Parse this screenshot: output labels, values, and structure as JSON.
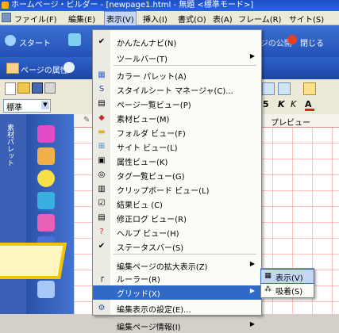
{
  "window": {
    "title": "ホームページ・ビルダー - [newpage1.html - 無題 <標準モード>]"
  },
  "menubar": {
    "items": [
      "ファイル(F)",
      "編集(E)",
      "表示(V)",
      "挿入(I)",
      "書式(O)",
      "表(A)",
      "フレーム(R)",
      "サイト(S)"
    ]
  },
  "navbar": {
    "start_label": "スタート",
    "properties_label": "ページの属性",
    "publish_label": "ページの公開",
    "close_label": "閉じる"
  },
  "toolbar": {
    "style_value": "標準",
    "font_size": "5",
    "preview_tab": "プレビュー"
  },
  "left_panel": {
    "tab_label": "素材パレット"
  },
  "menu": {
    "items": [
      {
        "label": "かんたんナビ(N)",
        "icon": "checkmark-icon"
      },
      {
        "label": "ツールバー(T)",
        "icon": ""
      },
      {
        "label": "カラー パレット(A)",
        "icon": "palette-icon"
      },
      {
        "label": "スタイルシート マネージャ(C)...",
        "icon": "stylesheet-icon"
      },
      {
        "label": "ページ一覧ビュー(P)",
        "icon": "page-list-icon"
      },
      {
        "label": "素材ビュー(M)",
        "icon": "materials-icon"
      },
      {
        "label": "フォルダ ビュー(F)",
        "icon": "folder-icon"
      },
      {
        "label": "サイト ビュー(L)",
        "icon": "site-icon"
      },
      {
        "label": "属性ビュー(K)",
        "icon": "attributes-icon"
      },
      {
        "label": "タグ一覧ビュー(G)",
        "icon": "tag-list-icon"
      },
      {
        "label": "クリップボード ビュー(L)",
        "icon": "clipboard-icon"
      },
      {
        "label": "結果ビュ (C)",
        "icon": "results-icon"
      },
      {
        "label": "修正ログ ビュー(R)",
        "icon": "log-icon"
      },
      {
        "label": "ヘルプ ビュー(H)",
        "icon": "help-icon"
      },
      {
        "label": "ステータスバー(S)",
        "icon": "checkmark-icon"
      },
      {
        "label": "編集ページの拡大表示(Z)",
        "icon": ""
      },
      {
        "label": "ルーラー(R)",
        "icon": "ruler-icon"
      },
      {
        "label": "グリッド(X)",
        "icon": ""
      },
      {
        "label": "編集表示の設定(E)...",
        "icon": "settings-icon"
      },
      {
        "label": "編集ページ情報(I)",
        "icon": ""
      }
    ]
  },
  "submenu": {
    "items": [
      {
        "label": "表示(V)",
        "icon": "grid-display-icon"
      },
      {
        "label": "吸着(S)",
        "icon": "snap-icon"
      }
    ]
  },
  "colors": {
    "highlight": "#3169c6",
    "titlebar": "#1c4fc3",
    "grid_line": "#ff7878",
    "callout_border": "#f4c400"
  }
}
